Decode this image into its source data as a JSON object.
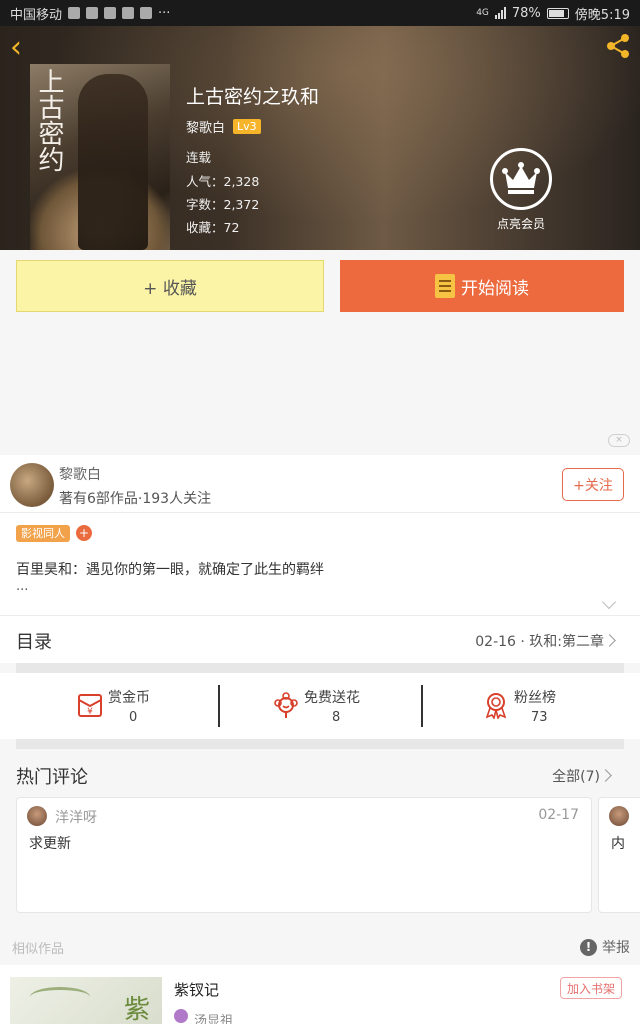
{
  "status_bar": {
    "carrier": "中国移动",
    "more": "···",
    "signal": "4G",
    "battery": "78%",
    "battery_level": 0.78,
    "time": "傍晚5:19"
  },
  "header": {
    "back": "‹",
    "book_title": "上古密约之玖和",
    "cover_title": "上古密约",
    "author": "黎歌白",
    "level": "Lv3",
    "status": "连载",
    "popularity": "人气：2,328",
    "word_count": "字数：2,372",
    "favorites": "收藏：72",
    "vip_label": "点亮会员"
  },
  "actions": {
    "collect_label": "+ 收藏",
    "read_label": "开始阅读"
  },
  "ad_close": "×",
  "author_card": {
    "name": "黎歌白",
    "meta": "著有6部作品·193人关注",
    "follow_label": "+关注"
  },
  "tags": {
    "items": [
      "影视同人"
    ],
    "add": "+"
  },
  "intro": {
    "text": "百里昊和：遇见你的第一眼，就确定了此生的羁绊",
    "ellipsis": "..."
  },
  "toc": {
    "title": "目录",
    "latest": "02-16 · 玖和:第二章"
  },
  "stats": [
    {
      "label": "赏金币",
      "value": "0",
      "icon": "red-envelope-icon"
    },
    {
      "label": "免费送花",
      "value": "8",
      "icon": "flower-icon"
    },
    {
      "label": "粉丝榜",
      "value": "73",
      "icon": "medal-icon"
    }
  ],
  "comments": {
    "title": "热门评论",
    "all_label": "全部(7)",
    "items": [
      {
        "user": "洋洋呀",
        "date": "02-17",
        "text": "求更新"
      },
      {
        "user": "",
        "date": "",
        "text": "内"
      }
    ]
  },
  "similar": {
    "title": "相似作品",
    "report_label": "举报",
    "report_icon": "!",
    "items": [
      {
        "title": "紫钗记",
        "author": "汤显祖",
        "cover_char": "紫",
        "add_label": "加入书架"
      }
    ]
  },
  "colors": {
    "accent_orange": "#ec6a3e",
    "collect_yellow": "#fbf4a6",
    "back_gold": "#f3b629",
    "tag_orange": "#f1a24a",
    "level_badge": "#f6b42a"
  }
}
